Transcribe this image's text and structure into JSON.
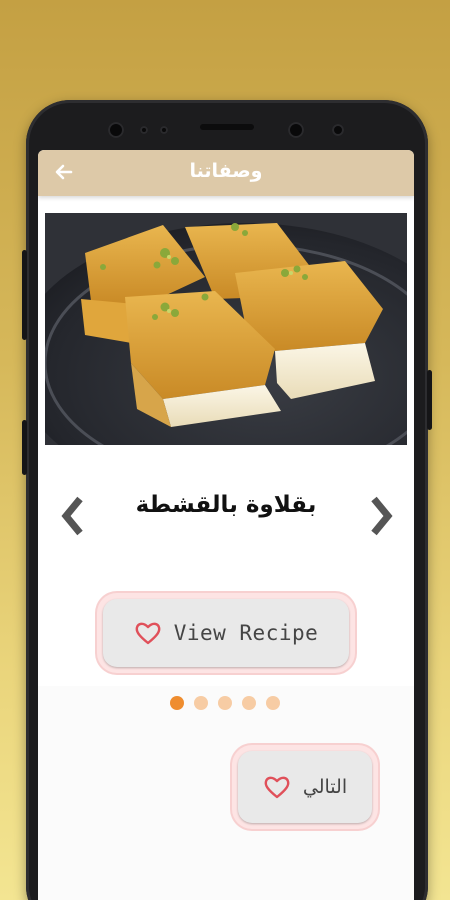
{
  "appbar": {
    "title": "وصفاتنا",
    "back_icon": "arrow-left-icon"
  },
  "recipe": {
    "name": "بقلاوة بالقشطة",
    "image": "baklava-photo"
  },
  "navigation": {
    "prev_icon": "chevron-left-icon",
    "next_icon": "chevron-right-icon"
  },
  "buttons": {
    "view_recipe_label": "View Recipe",
    "next_label": "التالي",
    "icon": "heart-outline-icon"
  },
  "pagination": {
    "count": 5,
    "active_index": 0
  },
  "colors": {
    "appbar": "#ddc9a8",
    "accent": "#ef8d2f",
    "dot_inactive": "#f7cca4",
    "heart": "#e0505a"
  }
}
